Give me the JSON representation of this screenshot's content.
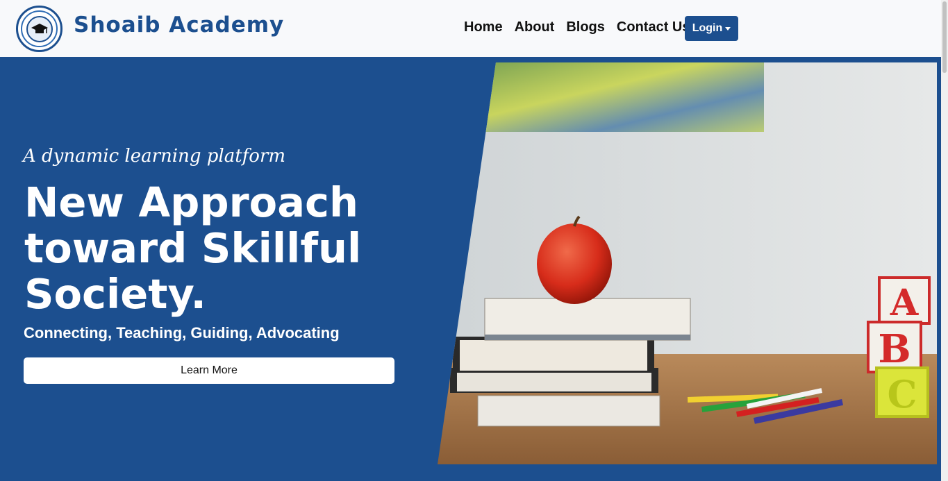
{
  "navbar": {
    "brand_name": "Shoaib Academy",
    "logo_icon": "academy-seal-logo",
    "links": [
      {
        "label": "Home"
      },
      {
        "label": "About"
      },
      {
        "label": "Blogs"
      },
      {
        "label": "Contact Us"
      }
    ],
    "login_label": "Login"
  },
  "hero": {
    "tagline": "A dynamic learning platform",
    "headline_lines": [
      "New Approach",
      "toward Skillful",
      "Society."
    ],
    "subline": "Connecting, Teaching, Guiding, Advocating",
    "cta_label": "Learn More",
    "photo_description_icon": "classroom-desk-photo",
    "block_letters": [
      "A",
      "B",
      "C"
    ]
  },
  "colors": {
    "brand_blue": "#1c4f8f",
    "navbar_bg": "#f8f9fb",
    "white": "#ffffff"
  }
}
